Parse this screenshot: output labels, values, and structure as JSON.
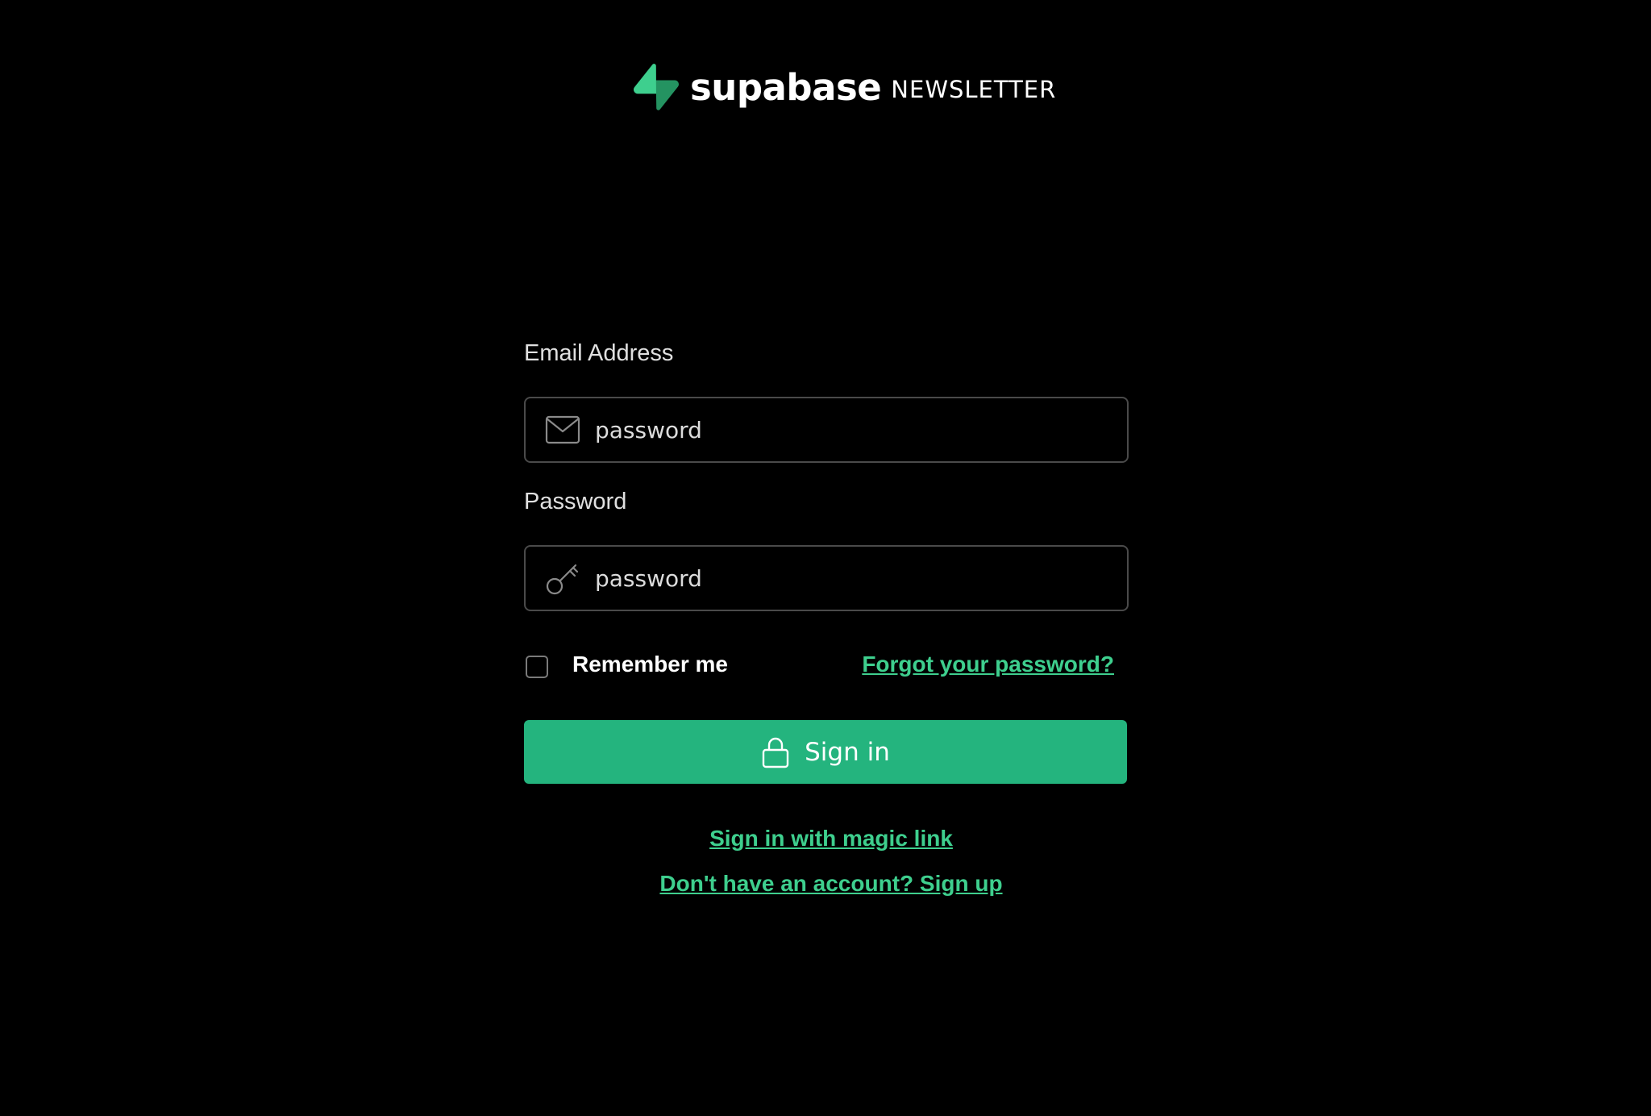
{
  "brand": {
    "name": "supabase",
    "subtitle": "NEWSLETTER",
    "logo_icon": "supabase-bolt-icon",
    "accent_color": "#3ecf8e"
  },
  "email": {
    "label": "Email Address",
    "placeholder": "password",
    "icon": "mail-icon"
  },
  "password": {
    "label": "Password",
    "placeholder": "password",
    "icon": "key-icon"
  },
  "remember": {
    "label": "Remember me",
    "checked": false
  },
  "forgot_link": "Forgot your password?",
  "signin_button": {
    "label": "Sign in",
    "icon": "lock-icon",
    "color": "#24b47e"
  },
  "links": {
    "magic_link": "Sign in with magic link",
    "signup": "Don't have an account? Sign up"
  }
}
